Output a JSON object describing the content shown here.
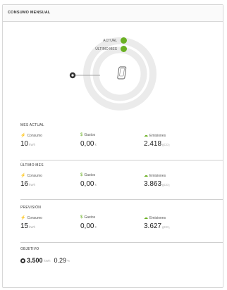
{
  "header": {
    "title": "CONSUMO MENSUAL"
  },
  "gauge": {
    "legend": [
      {
        "label": "ACTUAL",
        "color": "#6ab023"
      },
      {
        "label": "ÚLTIMO MES",
        "color": "#6ab023"
      }
    ],
    "track_color": "#ebebeb",
    "device_icon": "phone-icon",
    "target_icon": "target-icon"
  },
  "sections": [
    {
      "title": "MES ACTUAL",
      "consumo": {
        "label": "Consumo",
        "value": "10",
        "unit": "kWh"
      },
      "gastos": {
        "label": "Gastos",
        "value": "0,00",
        "unit": "€"
      },
      "emisiones": {
        "label": "Emisiones",
        "value": "2.418",
        "unit": "gCO₂"
      }
    },
    {
      "title": "ÚLTIMO MES",
      "consumo": {
        "label": "Consumo",
        "value": "16",
        "unit": "kWh"
      },
      "gastos": {
        "label": "Gastos",
        "value": "0,00",
        "unit": "€"
      },
      "emisiones": {
        "label": "Emisiones",
        "value": "3.863",
        "unit": "gCO₂"
      }
    },
    {
      "title": "PREVISIÓN",
      "consumo": {
        "label": "Consumo",
        "value": "15",
        "unit": "kWh"
      },
      "gastos": {
        "label": "Gastos",
        "value": "0,00",
        "unit": "€"
      },
      "emisiones": {
        "label": "Emisiones",
        "value": "3.627",
        "unit": "gCO₂"
      }
    }
  ],
  "objective": {
    "title": "OBJETIVO",
    "value": "3.500",
    "unit": "kWh",
    "percent": "0.29",
    "percent_unit": "%"
  },
  "icons": {
    "consumo": "bolt-icon",
    "gastos": "coins-icon",
    "emisiones": "cloud-icon"
  }
}
